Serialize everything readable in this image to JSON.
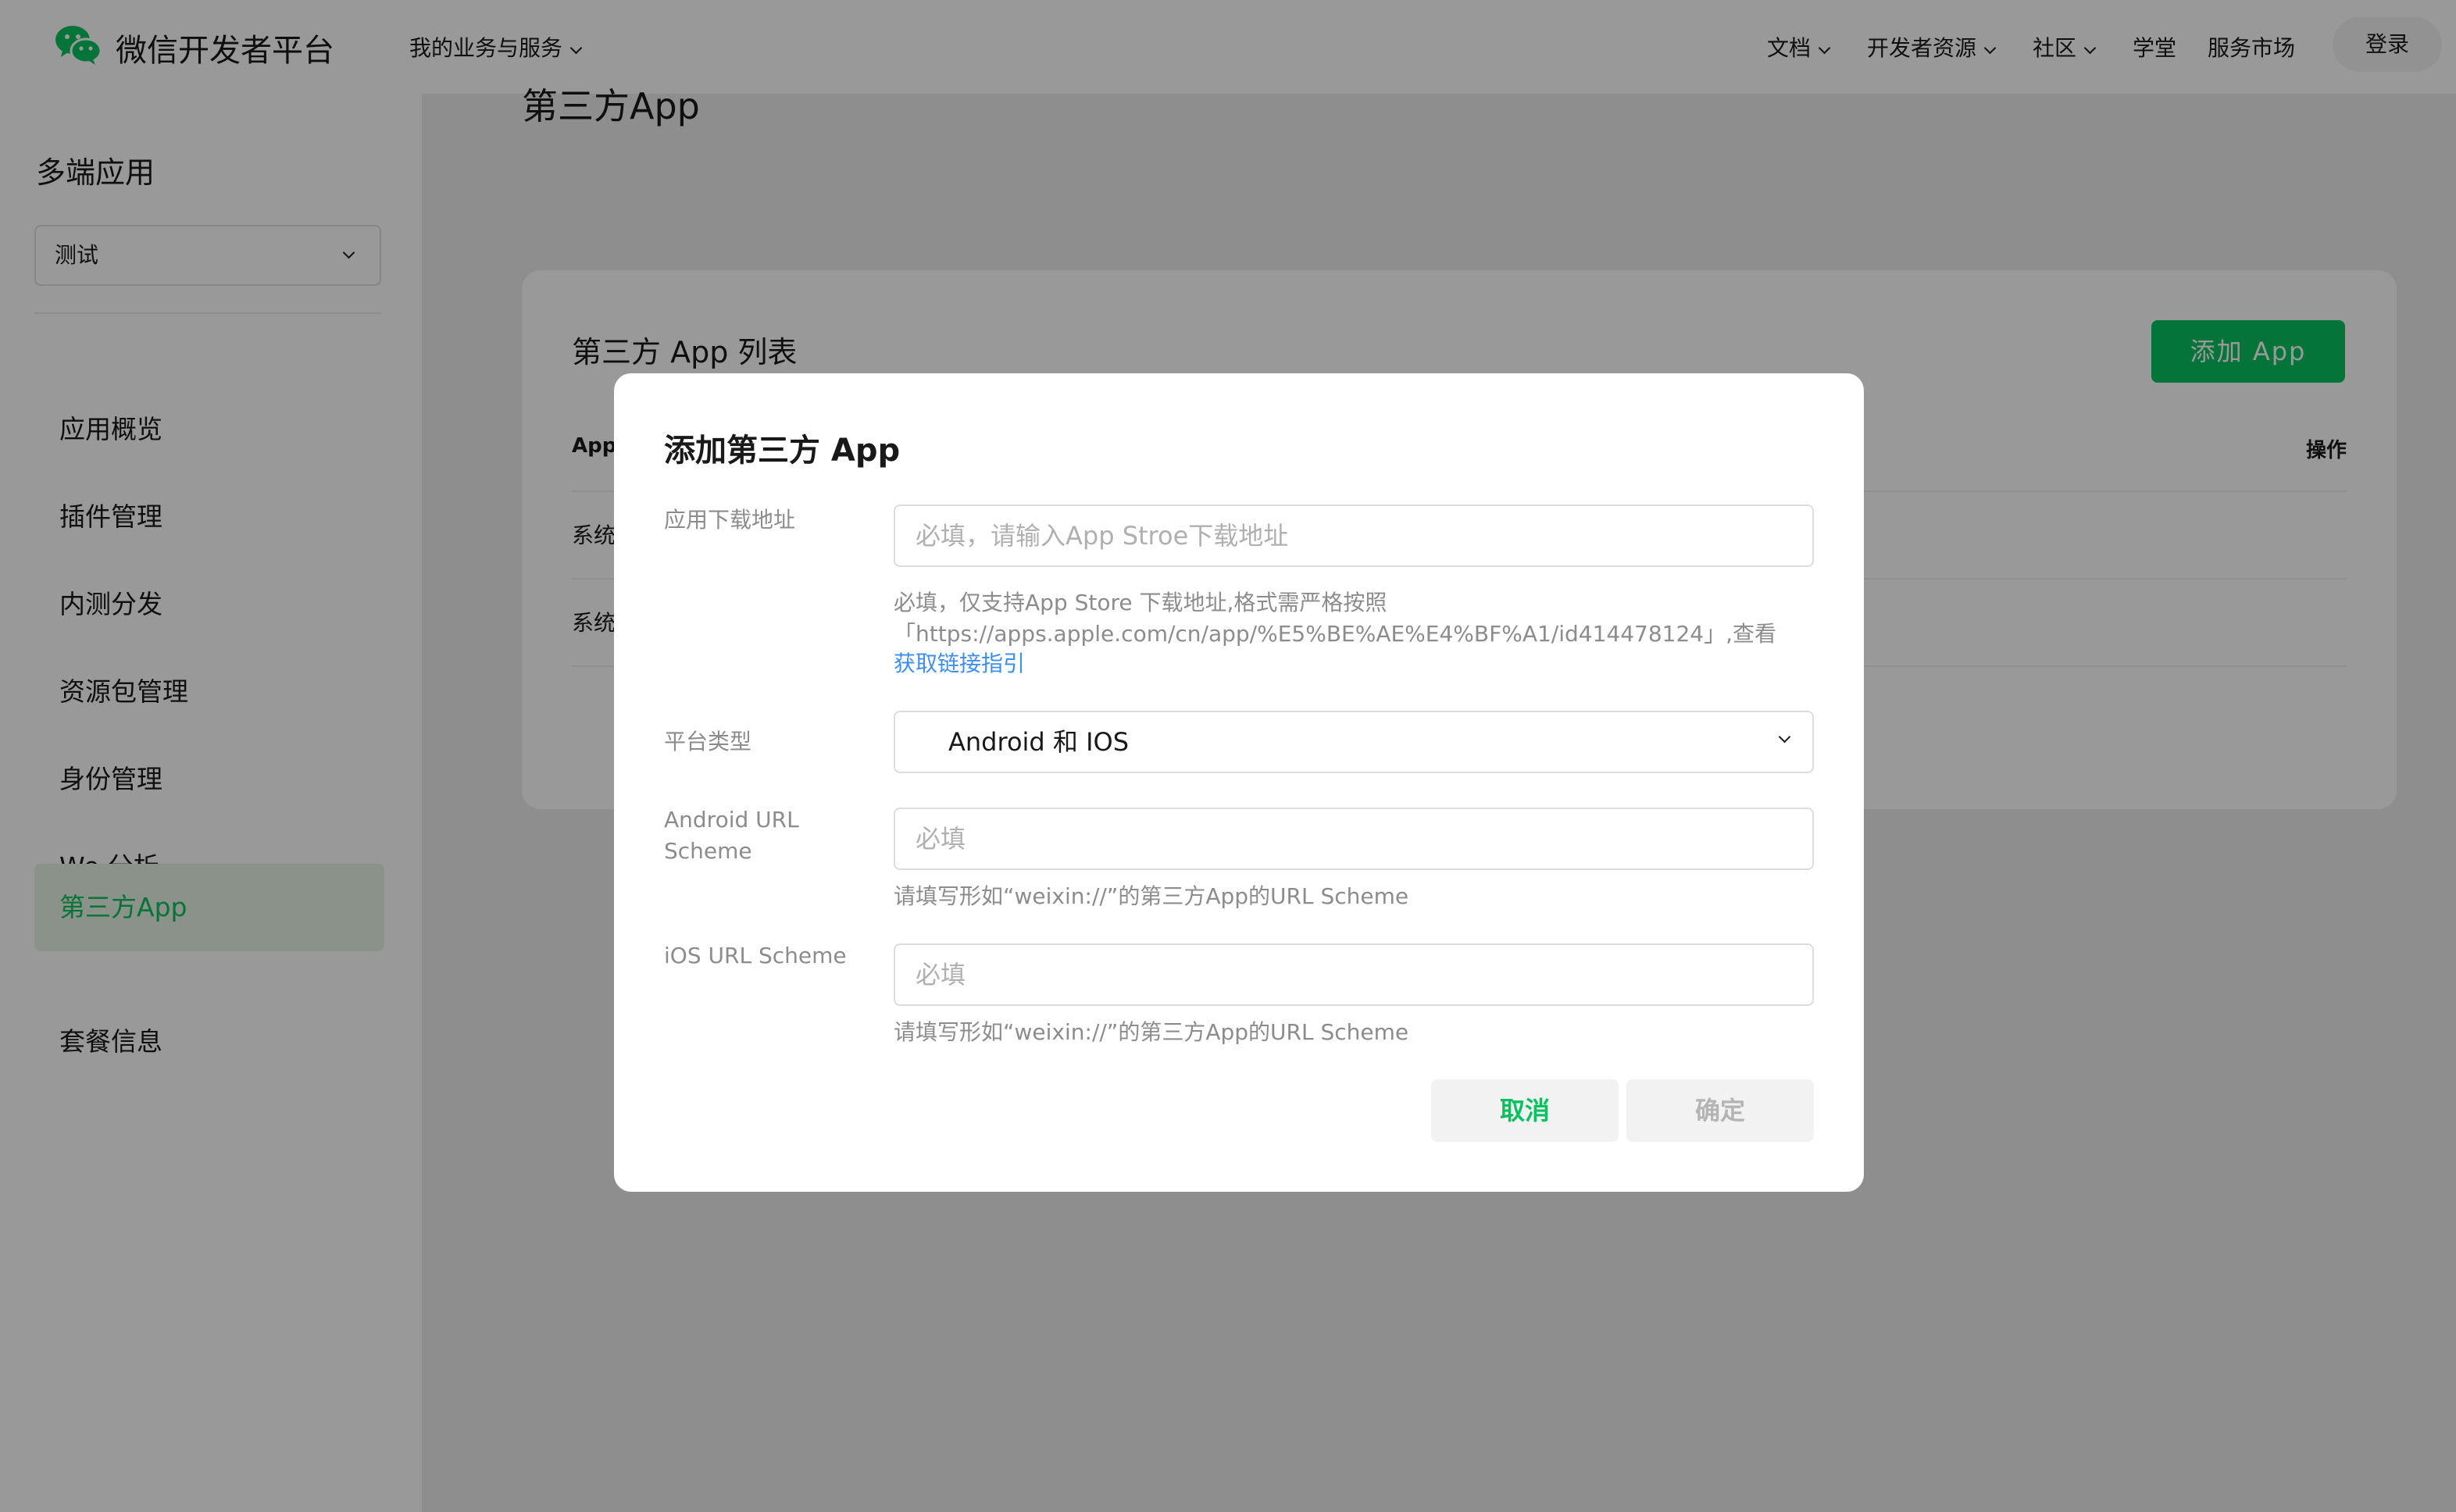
{
  "header": {
    "brand": "微信开发者平台",
    "services_menu": "我的业务与服务",
    "nav": [
      "文档",
      "开发者资源",
      "社区",
      "学堂",
      "服务市场"
    ],
    "login": "登录"
  },
  "sidebar": {
    "title": "多端应用",
    "select_value": "测试",
    "items": [
      {
        "label": "应用概览"
      },
      {
        "label": "插件管理"
      },
      {
        "label": "内测分发"
      },
      {
        "label": "资源包管理"
      },
      {
        "label": "身份管理"
      },
      {
        "label": "We 分析"
      },
      {
        "label": "第三方App",
        "active": true
      },
      {
        "label": "套餐信息"
      }
    ]
  },
  "main": {
    "page_title": "第三方App",
    "card_title": "第三方 App 列表",
    "add_button": "添加 App",
    "col_app": "App",
    "col_actions": "操作",
    "rows": [
      "系统",
      "系统"
    ]
  },
  "dialog": {
    "title": "添加第三方 App",
    "download_label": "应用下载地址",
    "download_placeholder": "必填，请输入App Stroe下载地址",
    "download_hint_1": "必填，仅支持App Store 下载地址,格式需严格按照",
    "download_hint_2": "「https://apps.apple.com/cn/app/%E5%BE%AE%E4%BF%A1/id414478124」,查看",
    "download_hint_link": "获取链接指引",
    "platform_label": "平台类型",
    "platform_value": "Android 和 IOS",
    "android_label": "Android URL Scheme",
    "android_placeholder": "必填",
    "android_hint": "请填写形如“weixin://”的第三方App的URL Scheme",
    "ios_label": "iOS URL Scheme",
    "ios_placeholder": "必填",
    "ios_hint": "请填写形如“weixin://”的第三方App的URL Scheme",
    "cancel": "取消",
    "confirm": "确定"
  },
  "colors": {
    "brand_green": "#07c160",
    "link_blue": "#3d8ef0",
    "overlay": "rgba(0,0,0,0.4)"
  }
}
